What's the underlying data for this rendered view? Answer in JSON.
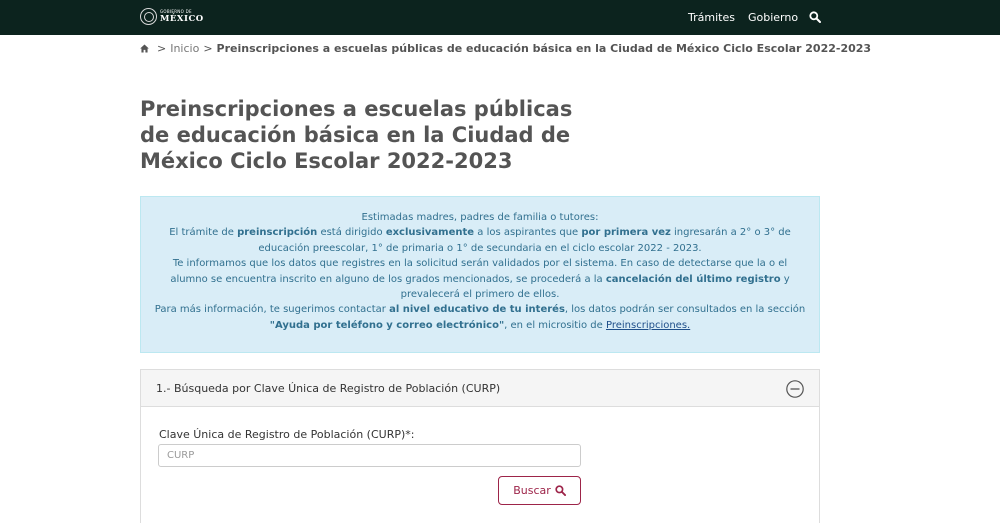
{
  "header": {
    "logo_small": "GOBIERNO DE",
    "logo_big": "MÉXICO",
    "nav": [
      "Trámites",
      "Gobierno"
    ],
    "search_icon": "search-icon",
    "background": "#0c231e"
  },
  "breadcrumb": {
    "home_icon": "home-icon",
    "sep": ">",
    "inicio": "Inicio",
    "current": "Preinscripciones a escuelas públicas de educación básica en la Ciudad de México Ciclo Escolar 2022-2023"
  },
  "page_title": "Preinscripciones a escuelas públicas de educación básica en la Ciudad de México Ciclo Escolar 2022-2023",
  "alert": {
    "greeting": "Estimadas madres, padres de familia o tutores:",
    "p1": {
      "a": "El trámite de ",
      "b": "preinscripción",
      "c": " está dirigido ",
      "d": "exclusivamente",
      "e": " a los aspirantes que ",
      "f": "por primera vez",
      "g": " ingresarán a 2° o 3° de educación preescolar, 1° de primaria o 1° de secundaria en el ciclo escolar 2022 - 2023."
    },
    "p2": {
      "a": "Te informamos que los datos que registres en la solicitud serán validados por el sistema. En caso de detectarse que la o el alumno se encuentra inscrito en alguno de los grados mencionados, se procederá a la ",
      "b": "cancelación del último registro",
      "c": " y prevalecerá el primero de ellos."
    },
    "p3": {
      "a": "Para más información, te sugerimos contactar ",
      "b": "al nivel educativo de tu interés",
      "c": ", los datos podrán ser consultados en la sección ",
      "d": "\"Ayuda por teléfono y correo electrónico\"",
      "e": ", en el micrositio de ",
      "link": "Preinscripciones."
    },
    "background": "#d9edf7"
  },
  "panel": {
    "title": "1.- Búsqueda por Clave Única de Registro de Población (CURP)",
    "collapse_icon": "minus-circle-icon",
    "field_label": "Clave Única de Registro de Población (CURP)*:",
    "input_value": "",
    "input_placeholder": "CURP",
    "button_label": "Buscar",
    "button_icon": "search-icon",
    "accent": "#9d2449"
  }
}
